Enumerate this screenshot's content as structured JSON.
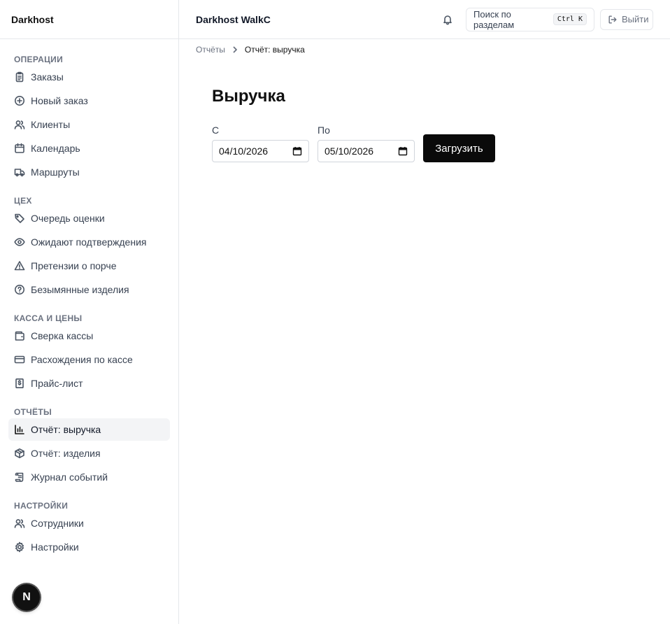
{
  "sidebar": {
    "brand": "Darkhost",
    "groups": [
      {
        "label": "ОПЕРАЦИИ",
        "items": [
          {
            "label": "Заказы",
            "icon": "clipboard-icon"
          },
          {
            "label": "Новый заказ",
            "icon": "plus-circle-icon"
          },
          {
            "label": "Клиенты",
            "icon": "users-icon"
          },
          {
            "label": "Календарь",
            "icon": "calendar-icon"
          },
          {
            "label": "Маршруты",
            "icon": "truck-icon"
          }
        ]
      },
      {
        "label": "ЦЕХ",
        "items": [
          {
            "label": "Очередь оценки",
            "icon": "tag-icon"
          },
          {
            "label": "Ожидают подтверждения",
            "icon": "eye-icon"
          },
          {
            "label": "Претензии о порче",
            "icon": "alert-triangle-icon"
          },
          {
            "label": "Безымянные изделия",
            "icon": "help-circle-icon"
          }
        ]
      },
      {
        "label": "КАССА И ЦЕНЫ",
        "items": [
          {
            "label": "Сверка кассы",
            "icon": "wallet-icon"
          },
          {
            "label": "Расхождения по кассе",
            "icon": "credit-card-icon"
          },
          {
            "label": "Прайс-лист",
            "icon": "receipt-dollar-icon"
          }
        ]
      },
      {
        "label": "ОТЧЁТЫ",
        "items": [
          {
            "label": "Отчёт: выручка",
            "icon": "bar-chart-icon",
            "active": true
          },
          {
            "label": "Отчёт: изделия",
            "icon": "package-icon"
          },
          {
            "label": "Журнал событий",
            "icon": "scroll-icon"
          }
        ]
      },
      {
        "label": "НАСТРОЙКИ",
        "items": [
          {
            "label": "Сотрудники",
            "icon": "users-icon"
          },
          {
            "label": "Настройки",
            "icon": "gear-icon"
          }
        ]
      }
    ],
    "fab_letter": "N"
  },
  "topbar": {
    "title": "Darkhost WalkC",
    "search_label": "Поиск по разделам",
    "search_shortcut": "Ctrl K",
    "logout_label": "Выйти"
  },
  "breadcrumb": {
    "parent": "Отчёты",
    "current": "Отчёт: выручка"
  },
  "main": {
    "title": "Выручка",
    "from_label": "С",
    "from_value": "04/10/2026",
    "to_label": "По",
    "to_value": "05/10/2026",
    "load_button": "Загрузить"
  }
}
